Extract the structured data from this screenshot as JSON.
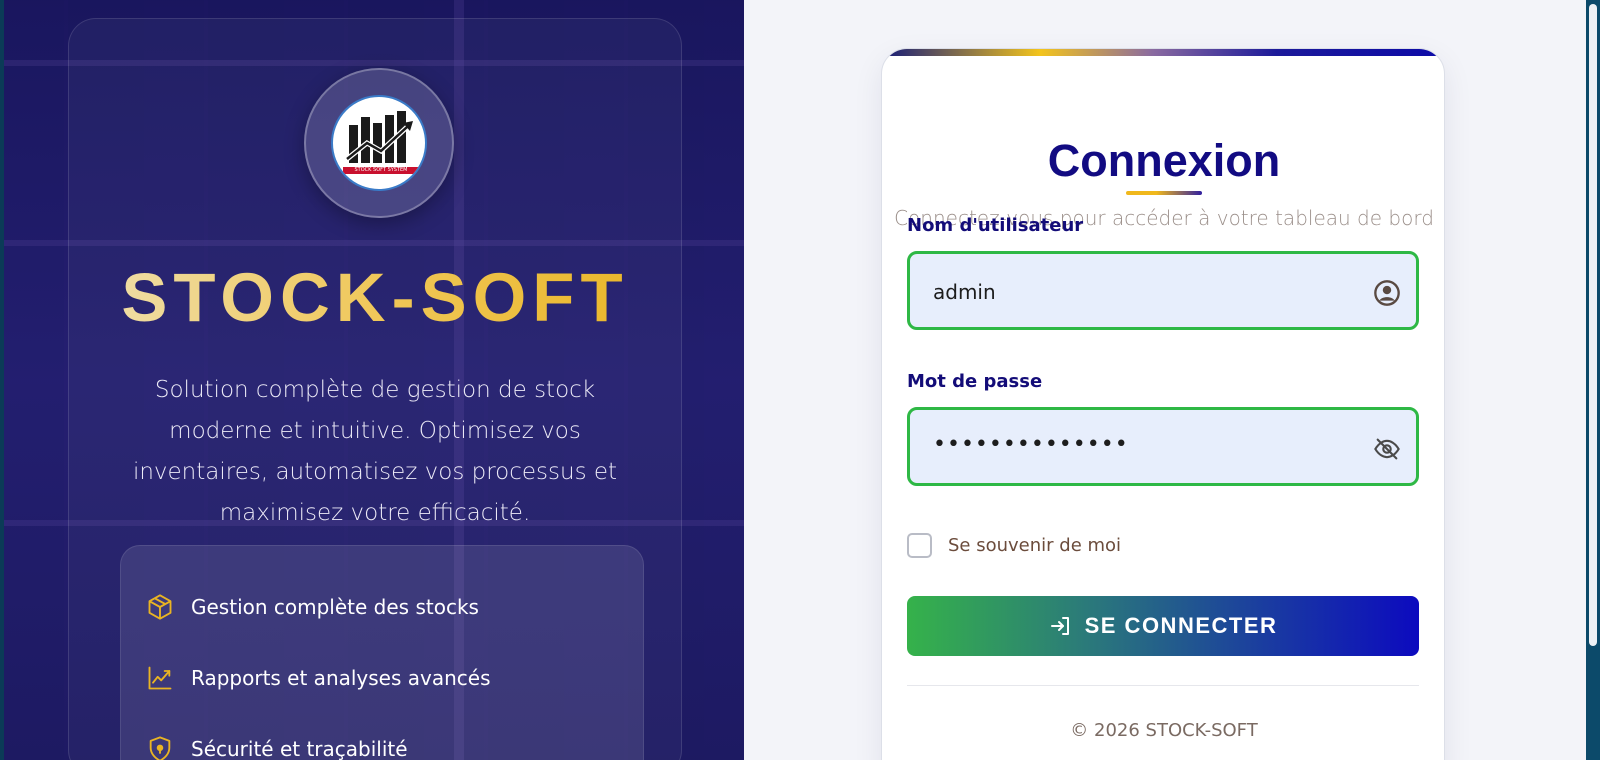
{
  "brand": {
    "name": "STOCK-SOFT",
    "logo_caption": "STOCK SOFT SYSTEM",
    "tagline": "Solution complète de gestion de stock moderne et intuitive. Optimisez vos inventaires, automatisez vos processus et maximisez votre efficacité."
  },
  "features": [
    {
      "icon": "box-icon",
      "label": "Gestion complète des stocks"
    },
    {
      "icon": "chart-line-icon",
      "label": "Rapports et analyses avancés"
    },
    {
      "icon": "shield-icon",
      "label": "Sécurité et traçabilité"
    }
  ],
  "login": {
    "title": "Connexion",
    "subtitle": "Connectez-vous pour accéder à votre tableau de bord",
    "username_label": "Nom d'utilisateur",
    "username_value": "admin",
    "password_label": "Mot de passe",
    "password_value": "••••••••••••••",
    "remember_label": "Se souvenir de moi",
    "remember_checked": false,
    "submit_label": "SE CONNECTER",
    "copyright": "© 2026 STOCK-SOFT"
  },
  "colors": {
    "accent_blue": "#120b82",
    "gold": "#f0c85a",
    "success_green": "#2eb845",
    "button_end": "#0c0abf"
  }
}
